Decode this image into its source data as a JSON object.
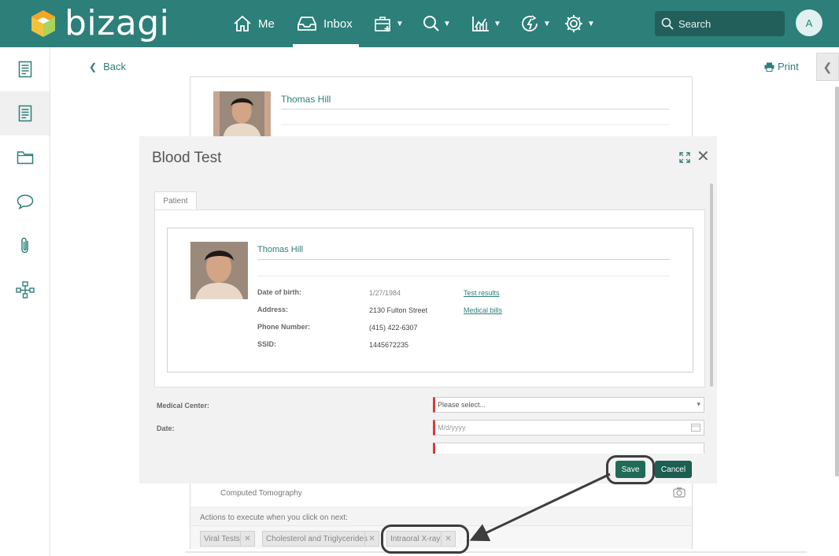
{
  "app": {
    "brand": "bizagi",
    "colors": {
      "primary": "#2d7f7a",
      "accent_required": "#d93a3a",
      "button": "#1f6b58"
    }
  },
  "nav": {
    "items": [
      {
        "label": "Me",
        "icon": "home-icon"
      },
      {
        "label": "Inbox",
        "icon": "inbox-icon",
        "active": true
      },
      {
        "label": "",
        "icon": "new-case-icon"
      },
      {
        "label": "",
        "icon": "search-icon"
      },
      {
        "label": "",
        "icon": "analytics-icon"
      },
      {
        "label": "",
        "icon": "activity-icon"
      },
      {
        "label": "",
        "icon": "settings-icon"
      }
    ],
    "search_placeholder": "Search",
    "avatar_initial": "A"
  },
  "sidebar": {
    "items": [
      {
        "icon": "form-icon"
      },
      {
        "icon": "form-icon",
        "active": true
      },
      {
        "icon": "folder-icon"
      },
      {
        "icon": "comment-icon"
      },
      {
        "icon": "attachment-icon"
      },
      {
        "icon": "process-map-icon"
      }
    ]
  },
  "page": {
    "back_label": "Back",
    "print_label": "Print",
    "patient_name": "Thomas Hill",
    "computed_tomography": "Computed Tomography",
    "actions_label": "Actions to execute when you click on next:",
    "action_tags": [
      "Viral Tests",
      "Cholesterol and Triglycerides",
      "Intraoral X-ray"
    ]
  },
  "modal": {
    "title": "Blood Test",
    "tab_label": "Patient",
    "patient": {
      "name": "Thomas Hill",
      "fields": [
        {
          "label": "Date of birth:",
          "value": "1/27/1984"
        },
        {
          "label": "Address:",
          "value": "2130 Fulton Street"
        },
        {
          "label": "Phone Number:",
          "value": "(415) 422-6307"
        },
        {
          "label": "SSID:",
          "value": "1445672235"
        }
      ],
      "links": [
        "Test results",
        "Medical bills"
      ]
    },
    "form": {
      "medical_center_label": "Medical Center:",
      "medical_center_value": "Please select...",
      "date_label": "Date:",
      "date_placeholder": "M/d/yyyy"
    },
    "buttons": {
      "save": "Save",
      "cancel": "Cancel"
    }
  }
}
